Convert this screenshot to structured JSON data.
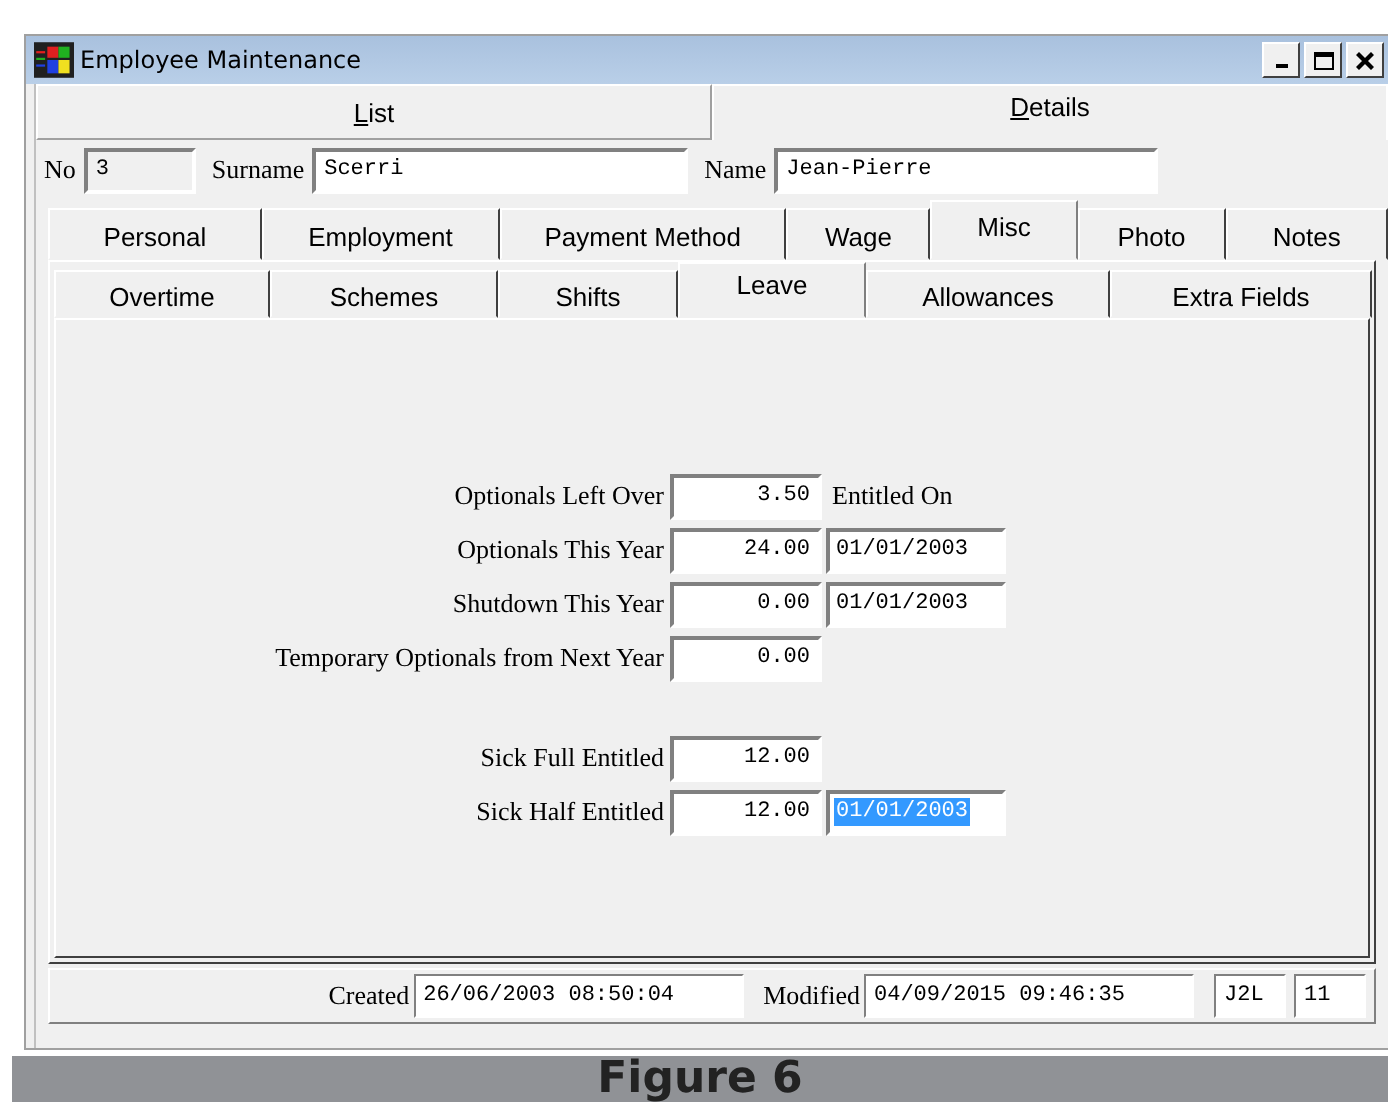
{
  "window": {
    "title": "Employee Maintenance"
  },
  "view_tabs": [
    {
      "label": "List",
      "selected": false
    },
    {
      "label": "Details",
      "selected": true
    }
  ],
  "header_fields": [
    {
      "label": "No",
      "value": "3"
    },
    {
      "label": "Surname",
      "value": "Scerri"
    },
    {
      "label": "Name",
      "value": "Jean-Pierre"
    }
  ],
  "tabs": [
    {
      "label": "Personal",
      "selected": false
    },
    {
      "label": "Employment",
      "selected": false
    },
    {
      "label": "Payment Method",
      "selected": false
    },
    {
      "label": "Wage",
      "selected": false
    },
    {
      "label": "Misc",
      "selected": true
    },
    {
      "label": "Photo",
      "selected": false
    },
    {
      "label": "Notes",
      "selected": false
    }
  ],
  "sub_tabs": [
    {
      "label": "Overtime",
      "selected": false
    },
    {
      "label": "Schemes",
      "selected": false
    },
    {
      "label": "Shifts",
      "selected": false
    },
    {
      "label": "Leave",
      "selected": true
    },
    {
      "label": "Allowances",
      "selected": false
    },
    {
      "label": "Extra Fields",
      "selected": false
    }
  ],
  "groups": [
    [
      {
        "label": "Optionals Left Over",
        "value": "3.50",
        "note": "Entitled On"
      },
      {
        "label": "Optionals This Year",
        "value": "24.00",
        "date": {
          "value": "01/01/2003",
          "selected": false
        }
      },
      {
        "label": "Shutdown This Year",
        "value": "0.00",
        "date": {
          "value": "01/01/2003",
          "selected": false
        }
      },
      {
        "label": "Temporary Optionals from Next Year",
        "value": "0.00"
      }
    ],
    [
      {
        "label": "Sick Full Entitled",
        "value": "12.00"
      },
      {
        "label": "Sick Half Entitled",
        "value": "12.00",
        "date": {
          "value": "01/01/2003",
          "selected": true
        }
      }
    ]
  ],
  "status_bar": {
    "created_label": "Created",
    "created": "26/06/2003 08:50:04",
    "modified_label": "Modified",
    "modified": "04/09/2015 09:46:35",
    "user": "J2L",
    "count": "11"
  },
  "caption": "Figure 6"
}
